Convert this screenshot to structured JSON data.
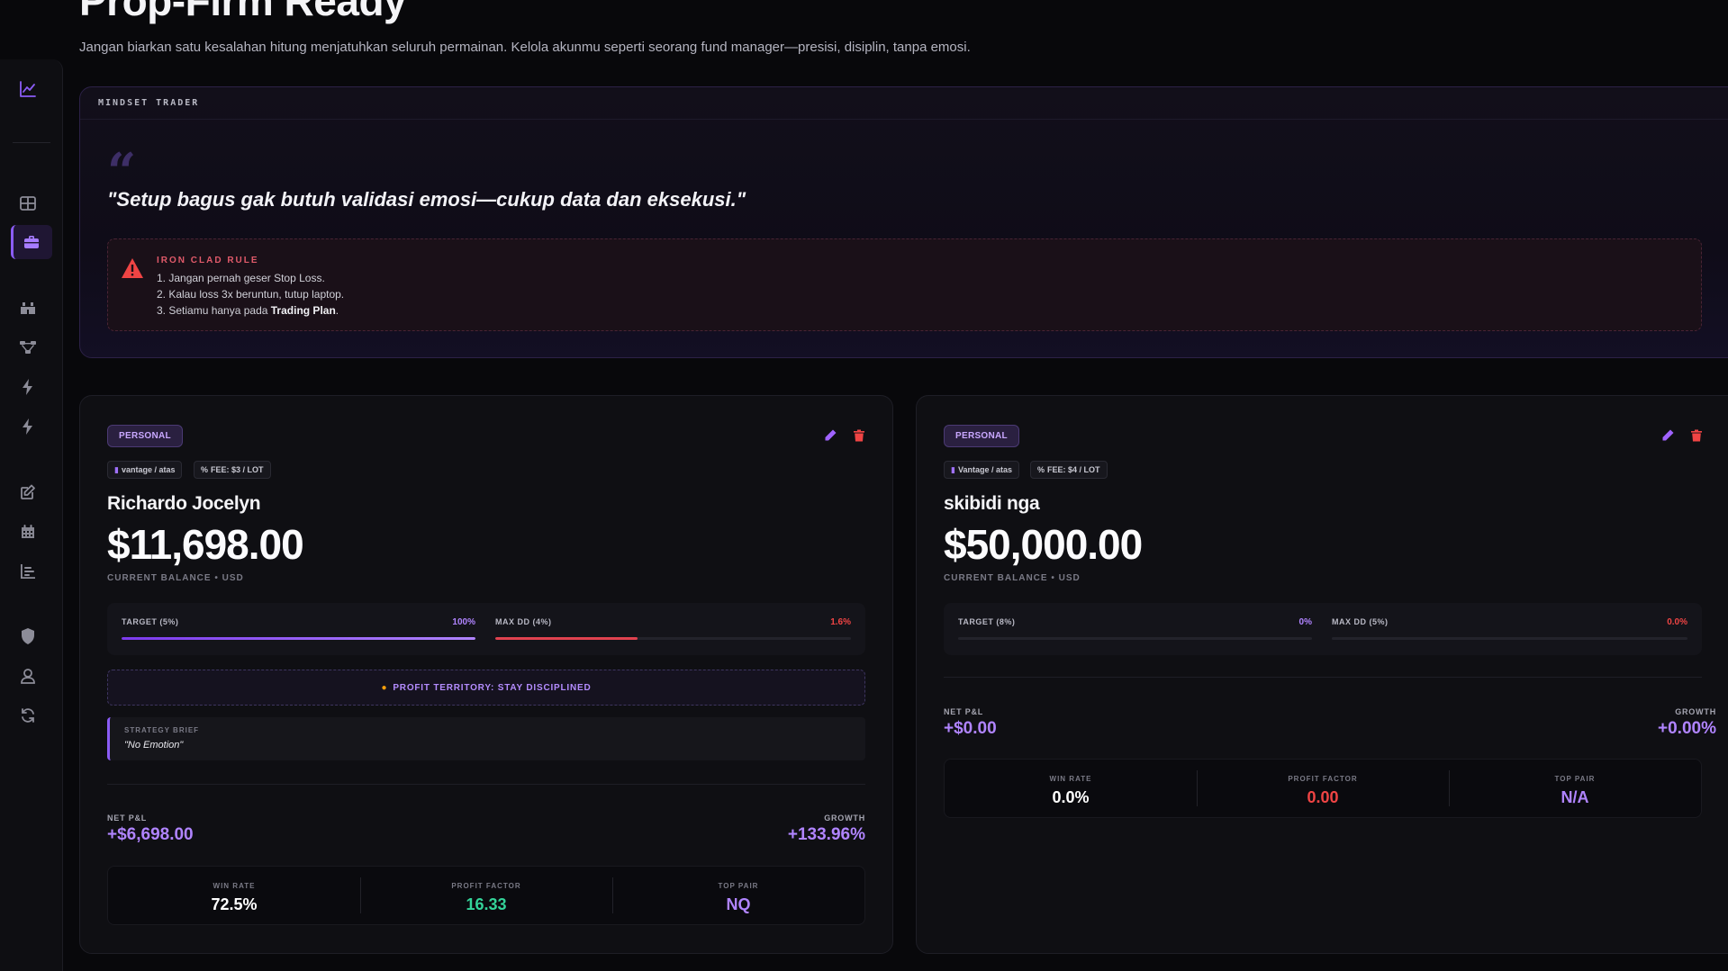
{
  "header": {
    "title": "Prop-Firm Ready",
    "subtitle": "Jangan biarkan satu kesalahan hitung menjatuhkan seluruh permainan. Kelola akunmu seperti seorang fund manager—presisi, disiplin, tanpa emosi."
  },
  "sidebar": {
    "icons": [
      "chart-line-icon",
      "grid-icon",
      "briefcase-icon",
      "binoculars-icon",
      "network-icon",
      "bolt-icon",
      "bolt-icon",
      "edit-icon",
      "calendar-icon",
      "bar-chart-icon",
      "shield-icon",
      "user-icon",
      "refresh-icon"
    ],
    "active": "briefcase-icon"
  },
  "mindset": {
    "label": "MINDSET TRADER",
    "quote": "\"Setup bagus gak butuh validasi emosi—cukup data dan eksekusi.\"",
    "rule_title": "IRON CLAD RULE",
    "rule_1": "1. Jangan pernah geser Stop Loss.",
    "rule_2": "2. Kalau loss 3x beruntun, tutup laptop.",
    "rule_3_prefix": "3. Setiamu hanya pada ",
    "rule_3_bold": "Trading Plan",
    "rule_3_suffix": "."
  },
  "accounts": [
    {
      "badge": "PERSONAL",
      "broker": "vantage / atas",
      "fee": "FEE: $3 / LOT",
      "name": "Richardo Jocelyn",
      "balance": "$11,698.00",
      "balance_label": "CURRENT BALANCE • USD",
      "target_label": "TARGET (5%)",
      "target_value": "100%",
      "target_progress": 1.0,
      "maxdd_label": "MAX DD (4%)",
      "maxdd_value": "1.6%",
      "maxdd_progress": 0.4,
      "status": "PROFIT TERRITORY: STAY DISCIPLINED",
      "brief_label": "STRATEGY BRIEF",
      "brief_text": "\"No Emotion\"",
      "pnl_label": "NET P&L",
      "pnl_value": "+$6,698.00",
      "growth_label": "GROWTH",
      "growth_value": "+133.96%",
      "stats": [
        {
          "label": "WIN RATE",
          "value": "72.5%",
          "color": "#ffffff"
        },
        {
          "label": "PROFIT FACTOR",
          "value": "16.33",
          "color": "#34d399"
        },
        {
          "label": "TOP PAIR",
          "value": "NQ",
          "color": "#b084ff"
        }
      ]
    },
    {
      "badge": "PERSONAL",
      "broker": "Vantage / atas",
      "fee": "FEE: $4 / LOT",
      "name": "skibidi nga",
      "balance": "$50,000.00",
      "balance_label": "CURRENT BALANCE • USD",
      "target_label": "TARGET (8%)",
      "target_value": "0%",
      "target_progress": 0.0,
      "maxdd_label": "MAX DD (5%)",
      "maxdd_value": "0.0%",
      "maxdd_progress": 0.0,
      "pnl_label": "NET P&L",
      "pnl_value": "+$0.00",
      "growth_label": "GROWTH",
      "growth_value": "+0.00%",
      "stats": [
        {
          "label": "WIN RATE",
          "value": "0.0%",
          "color": "#ffffff"
        },
        {
          "label": "PROFIT FACTOR",
          "value": "0.00",
          "color": "#ef4444"
        },
        {
          "label": "TOP PAIR",
          "value": "N/A",
          "color": "#b084ff"
        }
      ]
    }
  ],
  "colors": {
    "accent": "#8b5cf6",
    "danger": "#ef4444",
    "success": "#34d399"
  }
}
